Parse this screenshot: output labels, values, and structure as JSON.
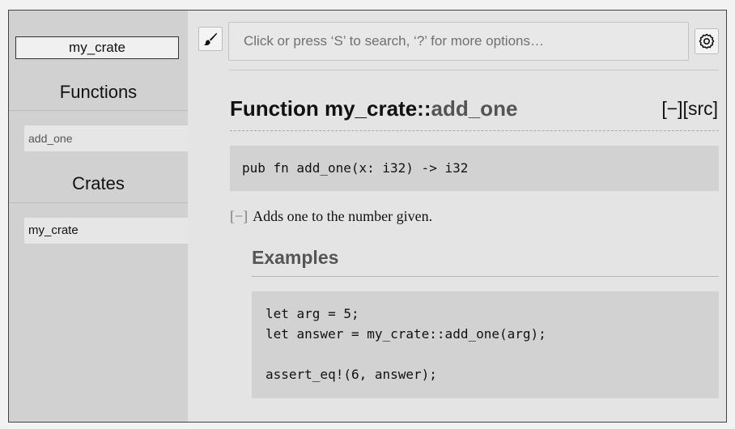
{
  "sidebar": {
    "crate_name": "my_crate",
    "sections": [
      {
        "heading": "Functions",
        "items": [
          "add_one"
        ]
      },
      {
        "heading": "Crates",
        "items": [
          "my_crate"
        ]
      }
    ]
  },
  "toolbar": {
    "theme_icon": "paintbrush-icon",
    "search_placeholder": "Click or press ‘S’ to search, ‘?’ for more options…",
    "settings_icon": "gear-icon"
  },
  "page": {
    "title_prefix": "Function my_crate::",
    "title_name": "add_one",
    "toggles": "[−][src]",
    "signature": "pub fn add_one(x: i32) -> i32",
    "doc_collapse": "[−]",
    "doc_text": "Adds one to the number given.",
    "examples_heading": "Examples",
    "example_code": [
      "let arg = 5;",
      "let answer = my_crate::add_one(arg);",
      "",
      "assert_eq!(6, answer);"
    ]
  }
}
